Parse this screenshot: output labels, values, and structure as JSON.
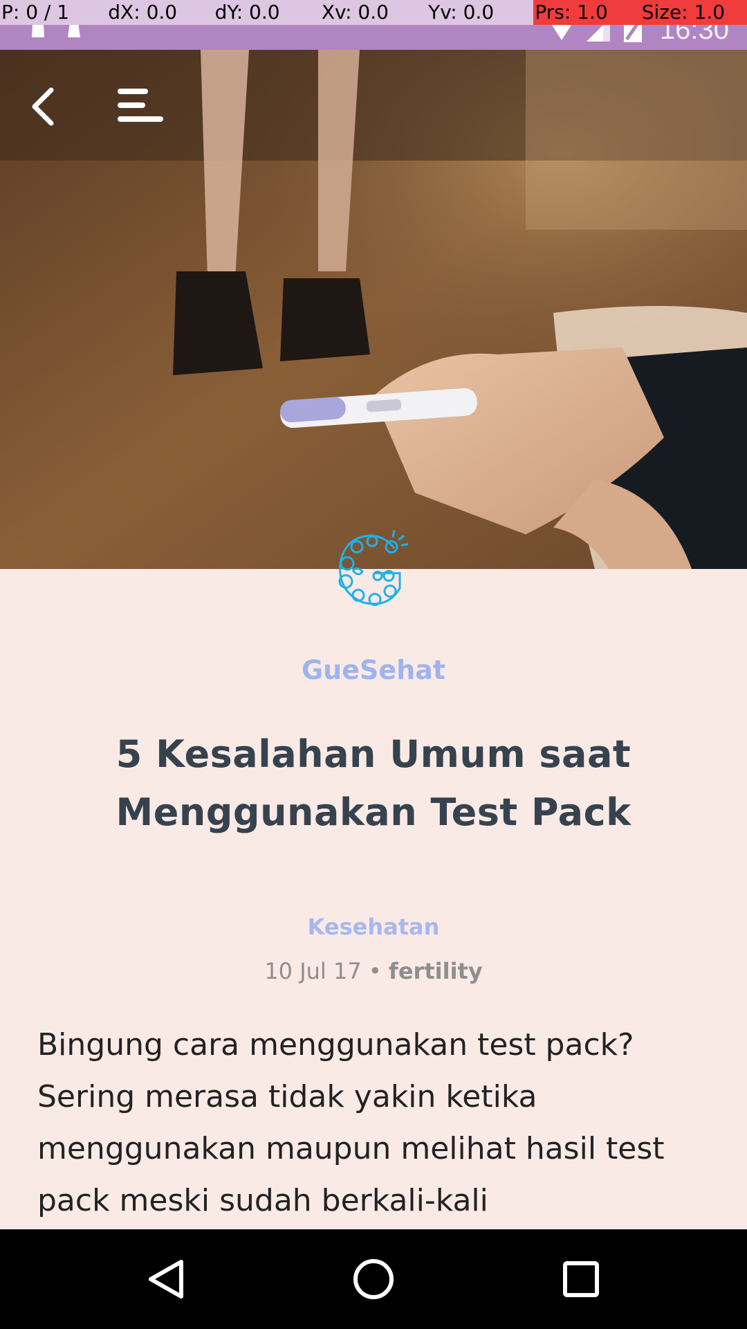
{
  "debug_overlay": {
    "pointer": "P: 0 / 1",
    "dx": "dX: 0.0",
    "dy": "dY: 0.0",
    "xv": "Xv: 0.0",
    "yv": "Yv: 0.0",
    "prs": "Prs: 1.0",
    "size": "Size: 1.0",
    "colors": {
      "normal": "#ddc6e2",
      "alert": "#f03c3c"
    }
  },
  "status_bar": {
    "time": "16:30",
    "background": "#b085c2",
    "icons": [
      "notification-icon",
      "notification-icon",
      "wifi-icon",
      "signal-icon",
      "battery-icon"
    ]
  },
  "header": {
    "back_icon": "back-arrow-icon",
    "menu_icon": "hamburger-menu-icon"
  },
  "article": {
    "brand": "GueSehat",
    "title": "5 Kesalahan Umum saat Menggunakan Test Pack",
    "category": "Kesehatan",
    "date": "10 Jul 17",
    "separator": "•",
    "tag": "fertility",
    "body": "Bingung cara menggunakan test pack? Sering merasa tidak yakin ketika menggunakan maupun melihat hasil test pack meski sudah berkali-kali",
    "colors": {
      "background": "#faeae6",
      "brand": "#9fb4ee",
      "title": "#36434f",
      "logo": "#1fb1e6"
    }
  },
  "nav_bar": {
    "back_icon": "nav-back-icon",
    "home_icon": "nav-home-icon",
    "recents_icon": "nav-recents-icon"
  }
}
